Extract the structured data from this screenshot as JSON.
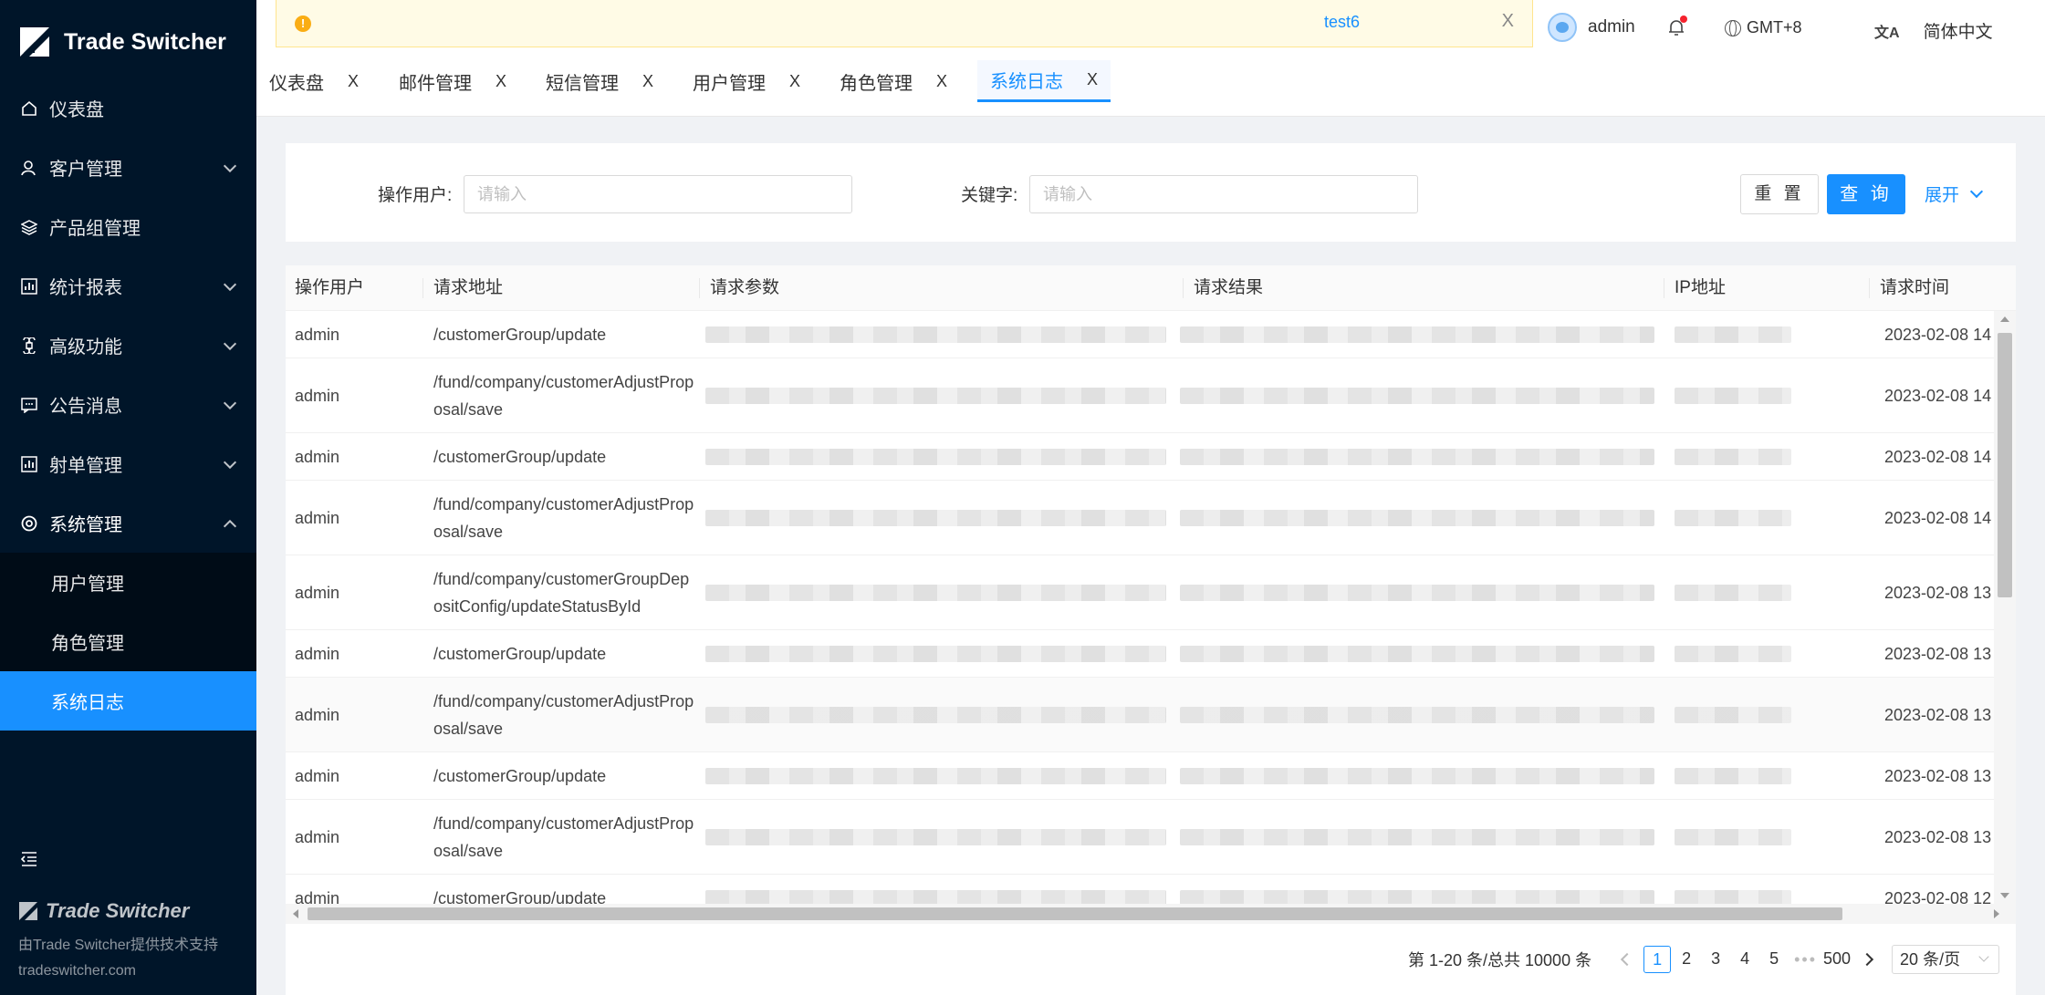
{
  "brand": {
    "name": "Trade Switcher",
    "footer_name": "Trade Switcher",
    "footer_line": "由Trade Switcher提供技术支持",
    "footer_url": "tradeswitcher.com"
  },
  "sidebar": {
    "items": [
      {
        "label": "仪表盘",
        "icon": "home-icon",
        "has_children": false
      },
      {
        "label": "客户管理",
        "icon": "user-icon",
        "has_children": true
      },
      {
        "label": "产品组管理",
        "icon": "layers-icon",
        "has_children": false
      },
      {
        "label": "统计报表",
        "icon": "bar-chart-icon",
        "has_children": true
      },
      {
        "label": "高级功能",
        "icon": "command-icon",
        "has_children": true
      },
      {
        "label": "公告消息",
        "icon": "message-icon",
        "has_children": true
      },
      {
        "label": "射单管理",
        "icon": "bar-chart-icon",
        "has_children": true
      },
      {
        "label": "系统管理",
        "icon": "settings-icon",
        "has_children": true,
        "open": true
      }
    ],
    "submenu": [
      {
        "label": "用户管理"
      },
      {
        "label": "角色管理"
      },
      {
        "label": "系统日志",
        "active": true
      }
    ]
  },
  "notice": {
    "message": "test6",
    "close": "X"
  },
  "header": {
    "username": "admin",
    "timezone": "GMT+8",
    "language": "简体中文",
    "lang_icon": "文A"
  },
  "tabs": [
    {
      "label": "仪表盘",
      "close": "X"
    },
    {
      "label": "邮件管理",
      "close": "X"
    },
    {
      "label": "短信管理",
      "close": "X"
    },
    {
      "label": "用户管理",
      "close": "X"
    },
    {
      "label": "角色管理",
      "close": "X"
    },
    {
      "label": "系统日志",
      "close": "X",
      "active": true
    }
  ],
  "search": {
    "user_label": "操作用户:",
    "user_placeholder": "请输入",
    "keyword_label": "关键字:",
    "keyword_placeholder": "请输入",
    "reset": "重 置",
    "query": "查 询",
    "expand": "展开"
  },
  "table": {
    "columns": [
      "操作用户",
      "请求地址",
      "请求参数",
      "请求结果",
      "IP地址",
      "请求时间"
    ],
    "rows": [
      {
        "user": "admin",
        "addr": "/customerGroup/update",
        "time": "2023-02-08 14"
      },
      {
        "user": "admin",
        "addr": "/fund/company/customerAdjustProposal/save",
        "time": "2023-02-08 14"
      },
      {
        "user": "admin",
        "addr": "/customerGroup/update",
        "time": "2023-02-08 14"
      },
      {
        "user": "admin",
        "addr": "/fund/company/customerAdjustProposal/save",
        "time": "2023-02-08 14"
      },
      {
        "user": "admin",
        "addr": "/fund/company/customerGroupDepositConfig/updateStatusById",
        "time": "2023-02-08 13"
      },
      {
        "user": "admin",
        "addr": "/customerGroup/update",
        "time": "2023-02-08 13"
      },
      {
        "user": "admin",
        "addr": "/fund/company/customerAdjustProposal/save",
        "time": "2023-02-08 13"
      },
      {
        "user": "admin",
        "addr": "/customerGroup/update",
        "time": "2023-02-08 13"
      },
      {
        "user": "admin",
        "addr": "/fund/company/customerAdjustProposal/save",
        "time": "2023-02-08 13"
      },
      {
        "user": "admin",
        "addr": "/customerGroup/update",
        "time": "2023-02-08 12"
      }
    ]
  },
  "pagination": {
    "total_text": "第 1-20 条/总共 10000 条",
    "pages": [
      "1",
      "2",
      "3",
      "4",
      "5"
    ],
    "ellipsis": "•••",
    "last_page": "500",
    "current": "1",
    "page_size": "20 条/页"
  },
  "colors": {
    "primary": "#1890ff",
    "sidebar_bg": "#001529",
    "submenu_bg": "#000c17",
    "notice_bg": "#fffbe6"
  }
}
